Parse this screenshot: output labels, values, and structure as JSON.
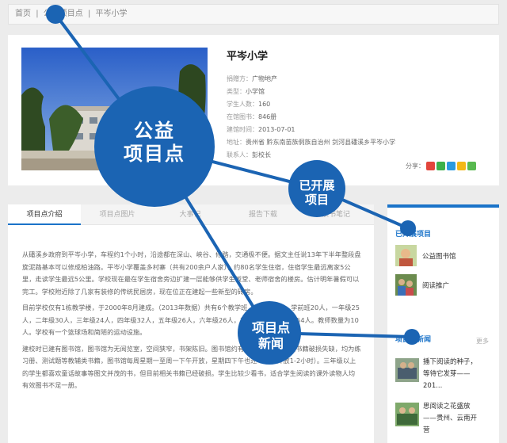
{
  "breadcrumb": [
    "首页",
    "公益项目点",
    "平岑小学"
  ],
  "school": {
    "title": "平岑小学",
    "fields": [
      {
        "label": "捐赠方：",
        "value": "广物地产"
      },
      {
        "label": "类型：",
        "value": "小学馆"
      },
      {
        "label": "学生人数：",
        "value": "160"
      },
      {
        "label": "在馆图书：",
        "value": "846册"
      },
      {
        "label": "建馆时间：",
        "value": "2013-07-01"
      },
      {
        "label": "地址：",
        "value": "贵州省 黔东南苗族侗族自治州 剑河县磻溪乡平岑小学"
      },
      {
        "label": "联系人：",
        "value": "彭校长"
      }
    ],
    "share_label": "分享："
  },
  "share_colors": [
    "#e2453b",
    "#3bb14a",
    "#2a9ae0",
    "#f3b815",
    "#58b94f"
  ],
  "tabs": [
    "项目点介绍",
    "项目点图片",
    "大事记",
    "报告下载",
    "读书笔记"
  ],
  "article": [
    "从磻溪乡政府到平岑小学，车程约1个小时，沿途都在深山、峡谷、修路，交通极不便。据文主任说13年下半年整段盘旋泥路基本可以修成柏油路。平岑小学覆盖多村寨（共有200余户人家），约80名学生住宿，住宿学生最远离家5公里，走读学生最远5公里。学校现在最在学生宿舍旁边扩建一层能够供学生饭堂、老师宿舍的楼房。估计明年暑假可以完工。学校附近除了几家有装修的传统民居房，现在位正在建起一些新型的砖房。",
    "目前学校仅有1栋教学楼，于2000年8月建成。（2013年数据）共有6个教学班，1个学前班。学前班20人，一年级25人，二年级30人，三年级24人，四年级32人，五年级26人，六年级26人，其中留守儿童约有154人。教师数量为10人。学校有一个篮球场和简陋的运动设施。",
    "建校时已建有图书馆，图书馆为无阅览室，空间狭窄，书架陈旧。图书馆约有500册，但大多数书籍破损失缺，均为练习册、测试题等教辅类书籍，图书馆每周星期一至周一下午开放，星期四下午也还（每次开放1-2小时）。三年级以上的学生都喜欢童话故事等图文并茂的书，但目前相关书籍已经破损。学生比较少看书，适合学生阅读的课外读物人均有效图书不足一册。"
  ],
  "sidebar": {
    "section1_title": "已开展项目",
    "projects": [
      "公益图书馆",
      "阅读推广"
    ],
    "section2_title": "项目点新闻",
    "more": "更多",
    "news": [
      {
        "line1": "播下阅读的种子，",
        "line2": "等待它发芽——",
        "line3": "201..."
      },
      {
        "line1": "思阅读之花盛放",
        "line2": "——贵州、云南开",
        "line3": "营"
      }
    ]
  },
  "overlay": {
    "big": [
      "公益",
      "项目点"
    ],
    "mid": [
      "已开展",
      "项目"
    ],
    "mid2": [
      "项目点",
      "新闻"
    ]
  },
  "accent": "#1b64b3"
}
